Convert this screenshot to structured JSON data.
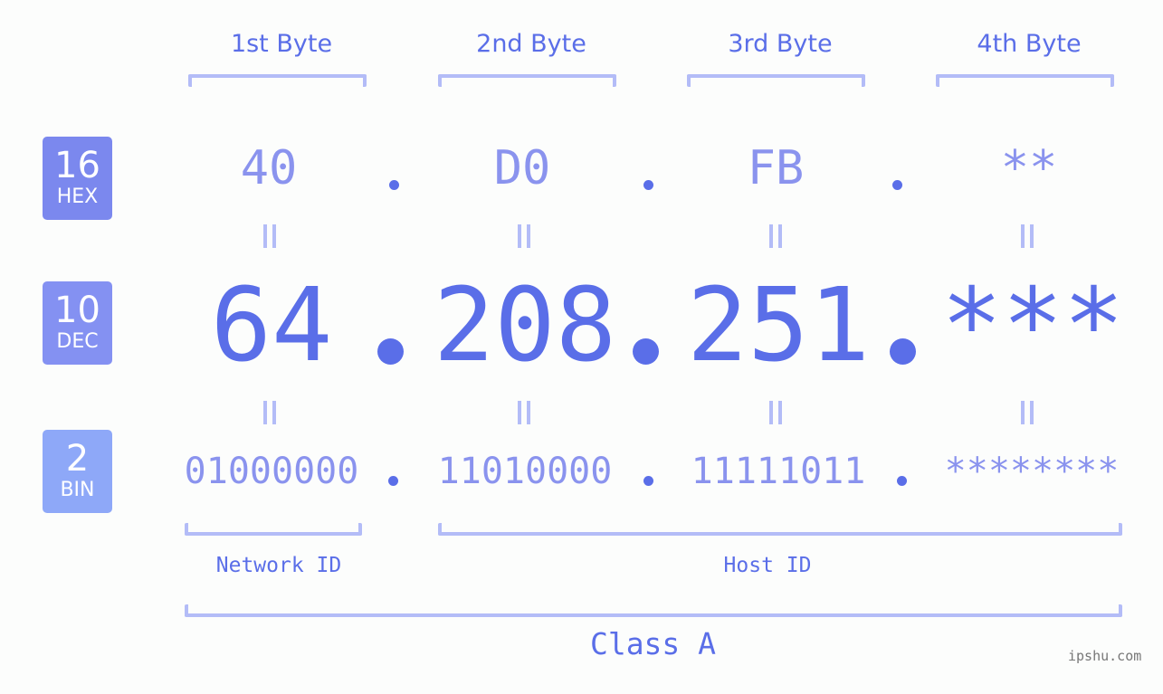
{
  "bytes": {
    "headers": [
      "1st Byte",
      "2nd Byte",
      "3rd Byte",
      "4th Byte"
    ]
  },
  "badges": {
    "hex": {
      "number": "16",
      "label": "HEX",
      "color": "#7b88ee"
    },
    "dec": {
      "number": "10",
      "label": "DEC",
      "color": "#8491f2"
    },
    "bin": {
      "number": "2",
      "label": "BIN",
      "color": "#8ea8f8"
    }
  },
  "hex_values": [
    "40",
    "D0",
    "FB",
    "**"
  ],
  "dec_values": [
    "64",
    "208",
    "251",
    "***"
  ],
  "bin_values": [
    "01000000",
    "11010000",
    "11111011",
    "********"
  ],
  "labels": {
    "network_id": "Network ID",
    "host_id": "Host ID",
    "class": "Class A"
  },
  "watermark": "ipshu.com",
  "colors": {
    "primary": "#5a6ee8",
    "secondary": "#8a93ee",
    "bracket": "#b3bcf7",
    "background": "#fcfdfc"
  }
}
